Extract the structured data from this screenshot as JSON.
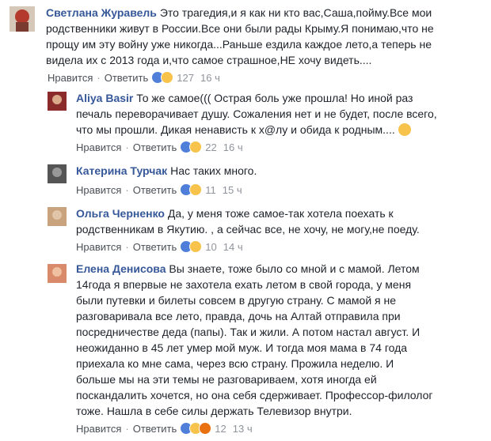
{
  "comments": [
    {
      "author": "Светлана Журавель",
      "lines": [
        "Это трагедия,и я как ни кто вас,Саша,пойму.Все мои",
        "родственники живут в России.Все они были рады Крыму.Я понимаю,что не",
        "прощу им эту войну уже никогда...Раньше ездила каждое лето,а теперь не",
        "видела их с 2013 года и,что самое страшное,НЕ хочу видеть...."
      ],
      "like": "Нравится",
      "reply": "Ответить",
      "count": "127",
      "time": "16 ч"
    },
    {
      "author": "Aliya Basir",
      "lines": [
        "То же самое((( Острая боль уже прошла! Но иной раз",
        "печаль переворачивает душу. Сожаления нет и не будет, после всего,",
        "что мы прошли. Дикая ненависть к х@лу и обида к родным...."
      ],
      "like": "Нравится",
      "reply": "Ответить",
      "count": "22",
      "time": "16 ч"
    },
    {
      "author": "Катерина Турчак",
      "lines": [
        "Нас таких много."
      ],
      "like": "Нравится",
      "reply": "Ответить",
      "count": "11",
      "time": "15 ч"
    },
    {
      "author": "Ольга Черненко",
      "lines": [
        "Да, у меня тоже самое-так хотела поехать к",
        "родственникам в Якутию. , а сейчас все, не хочу, не могу,не поеду."
      ],
      "like": "Нравится",
      "reply": "Ответить",
      "count": "10",
      "time": "14 ч"
    },
    {
      "author": "Елена Денисова",
      "lines": [
        "Вы знаете, тоже было со мной и с мамой. Летом",
        "14года я впервые не захотела ехать летом в свой города, у меня",
        "были путевки и билеты совсем в другую страну. С мамой я не",
        "разговаривала все лето, правда, дочь на Алтай отправила при",
        "посредничестве деда (папы). Так и жили. А потом настал август. И",
        "неожиданно в 45 лет умер мой муж. И тогда моя мама в 74 года",
        "приехала ко мне сама, через всю страну. Прожила неделю. И",
        "больше мы на эти темы не разговариваем, хотя иногда ей",
        "поскандалить хочется, но она себя сдерживает. Профессор-филолог",
        "тоже. Нашла в себе силы держать Телевизор внутри."
      ],
      "like": "Нравится",
      "reply": "Ответить",
      "count": "12",
      "time": "13 ч"
    }
  ],
  "colors": {
    "author": "#365899",
    "meta": "#90949c",
    "like_reaction": "#4f7fd9",
    "sad_reaction": "#f7c34a",
    "angry_reaction": "#e9710f"
  },
  "icons": [
    "like-reaction-icon",
    "sad-reaction-icon",
    "angry-reaction-icon",
    "sad-face-emoji"
  ]
}
